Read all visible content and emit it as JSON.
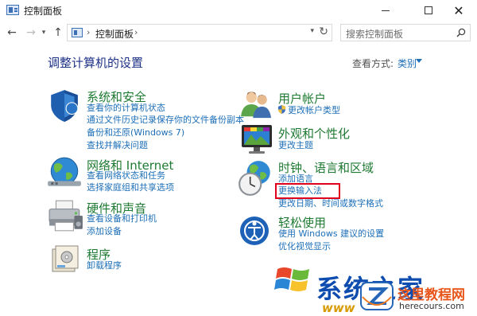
{
  "window": {
    "title": "控制面板",
    "buttons": {
      "minimize": "minimize",
      "maximize": "maximize",
      "close": "✕"
    }
  },
  "navigation": {
    "back": "←",
    "forward": "→",
    "up": "↑",
    "address": {
      "path": "控制面板",
      "separator": "›"
    },
    "search": {
      "placeholder": "搜索控制面板"
    }
  },
  "main": {
    "heading": "调整计算机的设置",
    "view_by_label": "查看方式:",
    "view_by_value": "类别"
  },
  "categories": [
    {
      "id": "system-security",
      "title": "系统和安全",
      "icon": "shield-icon",
      "links": [
        "查看你的计算机状态",
        "通过文件历史记录保存你的文件备份副本",
        "备份和还原(Windows 7)",
        "查找并解决问题"
      ]
    },
    {
      "id": "network-internet",
      "title": "网络和 Internet",
      "icon": "globe-network-icon",
      "links": [
        "查看网络状态和任务",
        "选择家庭组和共享选项"
      ]
    },
    {
      "id": "hardware-sound",
      "title": "硬件和声音",
      "icon": "printer-icon",
      "links": [
        "查看设备和打印机",
        "添加设备"
      ]
    },
    {
      "id": "programs",
      "title": "程序",
      "icon": "programs-icon",
      "links": [
        "卸载程序"
      ]
    },
    {
      "id": "user-accounts",
      "title": "用户帐户",
      "icon": "users-icon",
      "links": [
        "更改帐户类型"
      ]
    },
    {
      "id": "appearance",
      "title": "外观和个性化",
      "icon": "monitor-icon",
      "links": [
        "更改主题"
      ]
    },
    {
      "id": "clock-language",
      "title": "时钟、语言和区域",
      "icon": "clock-globe-icon",
      "links": [
        "添加语言",
        "更换输入法",
        "更改日期、时间或数字格式"
      ]
    },
    {
      "id": "ease-of-access",
      "title": "轻松使用",
      "icon": "ease-of-access-icon",
      "links": [
        "使用 Windows 建议的设置",
        "优化视觉显示"
      ]
    }
  ],
  "watermark": {
    "text1": "系统之家",
    "text2": "www",
    "site_title": "这里教程网",
    "site_url": "herecours.com"
  },
  "colors": {
    "heading": "#1e3287",
    "category_title": "#1e7a32",
    "link": "#1d6fb8",
    "highlight": "#e0001b"
  }
}
